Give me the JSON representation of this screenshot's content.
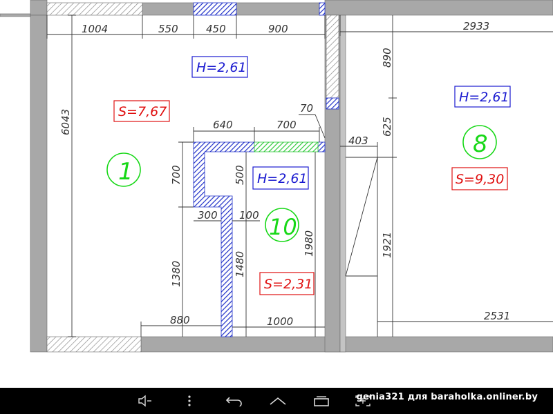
{
  "dimensions": {
    "top_1004": "1004",
    "top_550": "550",
    "top_450": "450",
    "top_900": "900",
    "top_2933": "2933",
    "left_6043": "6043",
    "right_890": "890",
    "right_625": "625",
    "right_1921": "1921",
    "right_403": "403",
    "right_2531": "2531",
    "inner_640": "640",
    "inner_700": "700",
    "inner_70": "70",
    "inner_700_vert": "700",
    "inner_500": "500",
    "inner_300": "300",
    "inner_100": "100",
    "inner_1380": "1380",
    "inner_1480": "1480",
    "inner_1980": "1980",
    "bottom_880": "880",
    "bottom_1000": "1000"
  },
  "rooms": {
    "room1": {
      "number": "1",
      "height": "H=2,61",
      "area": "S=7,67"
    },
    "room8": {
      "number": "8",
      "height": "H=2,61",
      "area": "S=9,30"
    },
    "room10": {
      "number": "10",
      "height": "H=2,61",
      "area": "S=2,31"
    }
  },
  "navbar": {
    "watermark": "genia321 для baraholka.onliner.by"
  },
  "colors": {
    "wall": "#a8a8a8",
    "hatch_blue": "#1f2fc8",
    "hatch_green": "#2fc83a",
    "room_number": "#18d818",
    "height_label": "#1a1ad0",
    "area_label": "#e01010"
  },
  "icons": [
    "volume-down-icon",
    "menu-dots-icon",
    "back-icon",
    "home-icon",
    "recent-apps-icon",
    "screenshot-icon",
    "volume-up-icon"
  ]
}
